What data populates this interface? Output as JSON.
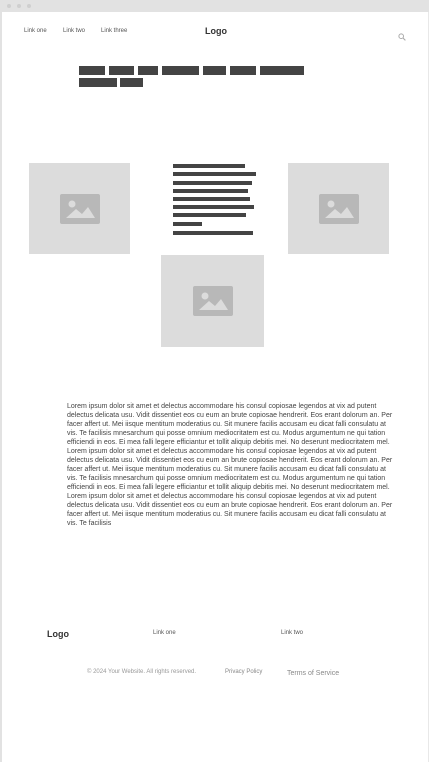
{
  "nav": {
    "links": [
      "Link one",
      "Link two",
      "Link three"
    ],
    "logo": "Logo",
    "search_icon": "search-icon"
  },
  "hero": {
    "heading_placeholder": "redacted heading text",
    "images": [
      "image-placeholder",
      "image-placeholder",
      "image-placeholder"
    ],
    "list_placeholder": "redacted list text"
  },
  "body": {
    "text": "Lorem ipsum dolor sit amet et delectus accommodare his consul copiosae legendos at vix ad putent delectus delicata usu. Vidit dissentiet eos cu eum an brute copiosae hendrerit. Eos erant dolorum an. Per facer affert ut. Mei iisque mentitum moderatius cu. Sit munere facilis accusam eu dicat falli consulatu at vis. Te facilisis mnesarchum qui posse omnium mediocritatem est cu. Modus argumentum ne qui tation efficiendi in eos. Ei mea falli legere efficiantur et tollit aliquip debitis mei. No deserunt mediocritatem mel. Lorem ipsum dolor sit amet et delectus accommodare his consul copiosae legendos at vix ad putent delectus delicata usu. Vidit dissentiet eos cu eum an brute copiosae hendrerit. Eos erant dolorum an. Per facer affert ut. Mei iisque mentitum moderatius cu. Sit munere facilis accusam eu dicat falli consulatu at vis. Te facilisis mnesarchum qui posse omnium mediocritatem est cu. Modus argumentum ne qui tation efficiendi in eos. Ei mea falli legere efficiantur et tollit aliquip debitis mei. No deserunt mediocritatem mel. Lorem ipsum dolor sit amet et delectus accommodare his consul copiosae legendos at vix ad putent delectus delicata usu. Vidit dissentiet eos cu eum an brute copiosae hendrerit. Eos erant dolorum an. Per facer affert ut. Mei iisque mentitum moderatius cu. Sit munere facilis accusam eu dicat falli consulatu at vis. Te facilisis"
  },
  "footer": {
    "logo": "Logo",
    "links": [
      "Link one",
      "Link two"
    ],
    "copyright": "© 2024 Your Website. All rights reserved.",
    "privacy": "Privacy Policy",
    "terms": "Terms of Service"
  },
  "colors": {
    "placeholder_bar": "#444444",
    "image_placeholder": "#dcdcdc",
    "chrome": "#e2e2e2"
  }
}
